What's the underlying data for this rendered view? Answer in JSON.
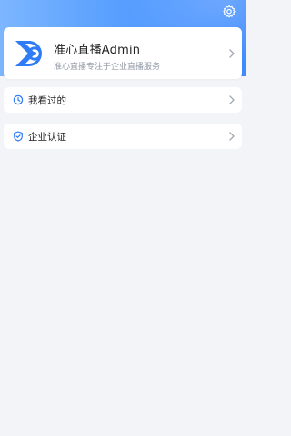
{
  "header": {
    "settings_icon": "gear-icon",
    "gradient_start": "#7cb6ff",
    "gradient_end": "#3f8cff"
  },
  "profile": {
    "app_name": "准心直播Admin",
    "description": "准心直播专注于企业直播服务",
    "logo_icon": "zhunxin-logo",
    "brand_color": "#2f7cf6"
  },
  "menu": [
    {
      "label": "我看过的",
      "icon": "clock-icon"
    },
    {
      "label": "企业认证",
      "icon": "shield-check-icon"
    }
  ]
}
